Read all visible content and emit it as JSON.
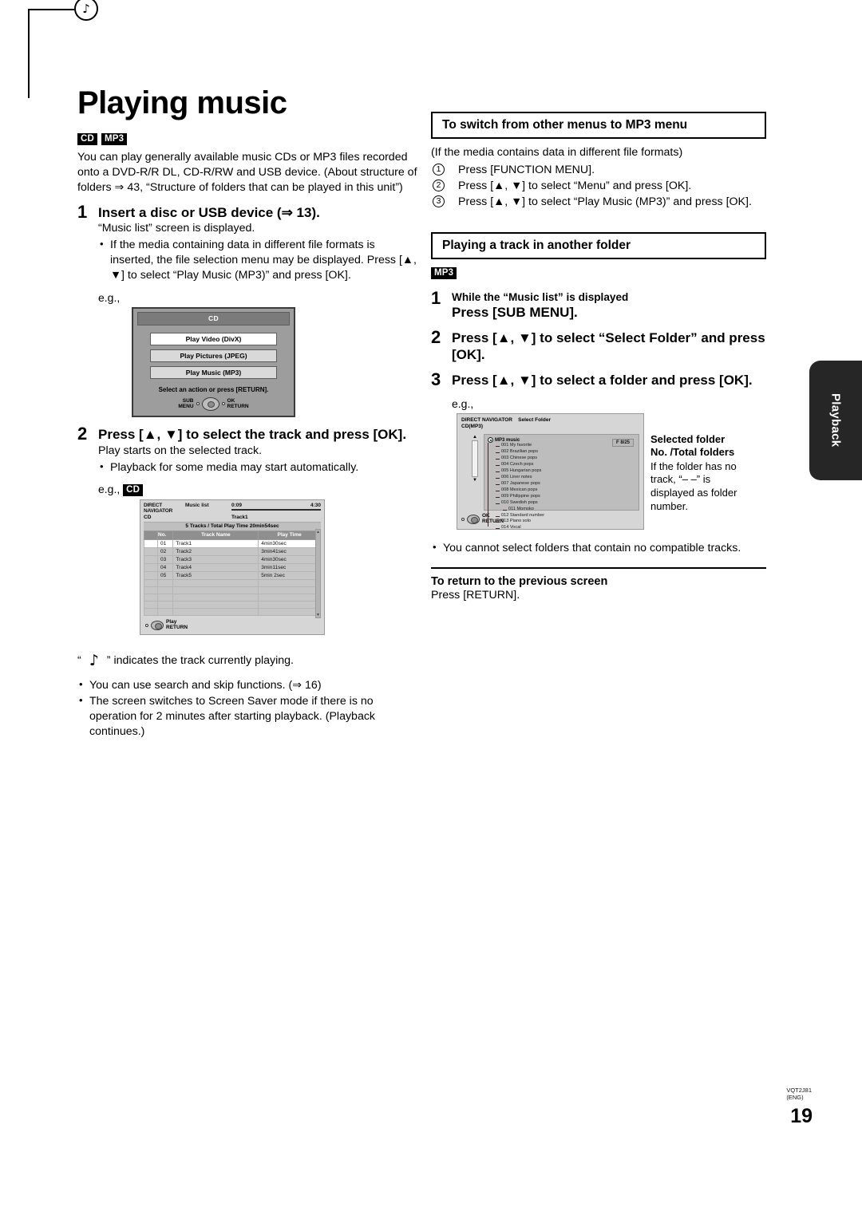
{
  "page": {
    "title": "Playing music",
    "footer_code_line1": "VQT2J81",
    "footer_code_line2": "(ENG)",
    "page_number": "19",
    "side_tab": "Playback"
  },
  "left": {
    "badges": [
      "CD",
      "MP3"
    ],
    "intro": "You can play generally available music CDs or MP3 files recorded onto a DVD-R/R DL, CD-R/RW and USB device. (About structure of folders ⇒ 43, “Structure of folders that can be played in this unit”)",
    "step1": {
      "num": "1",
      "heading": "Insert a disc or USB device (⇒ 13).",
      "line1": "“Music list” screen is displayed.",
      "bullet1": "If the media containing data in different file formats is inserted, the file selection menu may be displayed. Press [▲, ▼] to select “Play Music (MP3)” and press [OK].",
      "eg": "e.g.,"
    },
    "cd_dialog": {
      "title": "CD",
      "options": [
        "Play Video (DivX)",
        "Play Pictures (JPEG)",
        "Play Music (MP3)"
      ],
      "hint": "Select an action or press [RETURN].",
      "pad_left_line1": "SUB",
      "pad_left_line2": "MENU",
      "pad_right_line1": "OK",
      "pad_right_line2": "RETURN"
    },
    "step2": {
      "num": "2",
      "heading": "Press [▲, ▼] to select the track and press [OK].",
      "line1": "Play starts on the selected track.",
      "bullet1": "Playback for some media may start automatically.",
      "eg": "e.g.,",
      "eg_badge": "CD"
    },
    "music_screen": {
      "nav_label": "DIRECT NAVIGATOR",
      "screen_name": "Music list",
      "media": "CD",
      "elapsed": "0:09",
      "total": "4:30",
      "now_playing": "Track1",
      "summary": "5 Tracks / Total Play Time 20min54sec",
      "columns": [
        "No.",
        "Track Name",
        "Play Time"
      ],
      "rows": [
        {
          "no": "01",
          "name": "Track1",
          "time": "4min30sec",
          "playing": true
        },
        {
          "no": "02",
          "name": "Track2",
          "time": "3min41sec",
          "playing": false
        },
        {
          "no": "03",
          "name": "Track3",
          "time": "4min30sec",
          "playing": false
        },
        {
          "no": "04",
          "name": "Track4",
          "time": "3min11sec",
          "playing": false
        },
        {
          "no": "05",
          "name": "Track5",
          "time": "5min 2sec",
          "playing": false
        }
      ],
      "foot_line1": "Play",
      "foot_line2": "RETURN"
    },
    "note_caption": "“        ” indicates the track currently playing.",
    "note_caption_pre": "“",
    "note_caption_post": "” indicates the track currently playing.",
    "bullets": [
      "You can use search and skip functions. (⇒ 16)",
      "The screen switches to Screen Saver mode if there is no operation for 2 minutes after starting playback. (Playback continues.)"
    ]
  },
  "right": {
    "section1": {
      "heading": "To switch from other menus to MP3 menu",
      "intro": "(If the media contains data in different file formats)",
      "steps": [
        "Press [FUNCTION MENU].",
        "Press [▲, ▼] to select “Menu” and press [OK].",
        "Press [▲, ▼] to select “Play Music (MP3)” and press [OK]."
      ]
    },
    "section2": {
      "heading": "Playing a track in another folder",
      "badge": "MP3",
      "step1_num": "1",
      "step1_lead": "While the “Music list” is displayed",
      "step1_main": "Press [SUB MENU].",
      "step2_num": "2",
      "step2_main": "Press [▲, ▼] to select “Select Folder” and press [OK].",
      "step3_num": "3",
      "step3_main": "Press [▲, ▼] to select a folder and press [OK].",
      "eg": "e.g.,"
    },
    "folder_screen": {
      "nav_label": "DIRECT NAVIGATOR",
      "screen_name": "Select Folder",
      "media": "CD(MP3)",
      "root": "MP3 music",
      "badge": "F 8/25",
      "folders": [
        {
          "label": "001 My favorite",
          "indent": false
        },
        {
          "label": "002 Brazilian pops",
          "indent": false
        },
        {
          "label": "003 Chinese pops",
          "indent": false
        },
        {
          "label": "004 Czech pops",
          "indent": false
        },
        {
          "label": "005 Hungarian pops",
          "indent": false
        },
        {
          "label": "006 Liner notes",
          "indent": false
        },
        {
          "label": "007 Japanese pops",
          "indent": false
        },
        {
          "label": "008 Mexican pops",
          "indent": false
        },
        {
          "label": "009 Philippine pops",
          "indent": false
        },
        {
          "label": "010 Swedish pops",
          "indent": false
        },
        {
          "label": "011 Momoko",
          "indent": true
        },
        {
          "label": "012 Standard number",
          "indent": false
        },
        {
          "label": "013 Piano solo",
          "indent": false
        },
        {
          "label": "014 Vocal",
          "indent": false
        }
      ],
      "foot_line1": "OK",
      "foot_line2": "RETURN"
    },
    "callout": {
      "title_line1": "Selected folder",
      "title_line2": "No. /Total folders",
      "body": "If the folder has no track, “– –” is displayed as folder number."
    },
    "note_bullet": "You cannot select folders that contain no compatible tracks.",
    "section3": {
      "heading": "To return to the previous screen",
      "body": "Press [RETURN]."
    }
  }
}
